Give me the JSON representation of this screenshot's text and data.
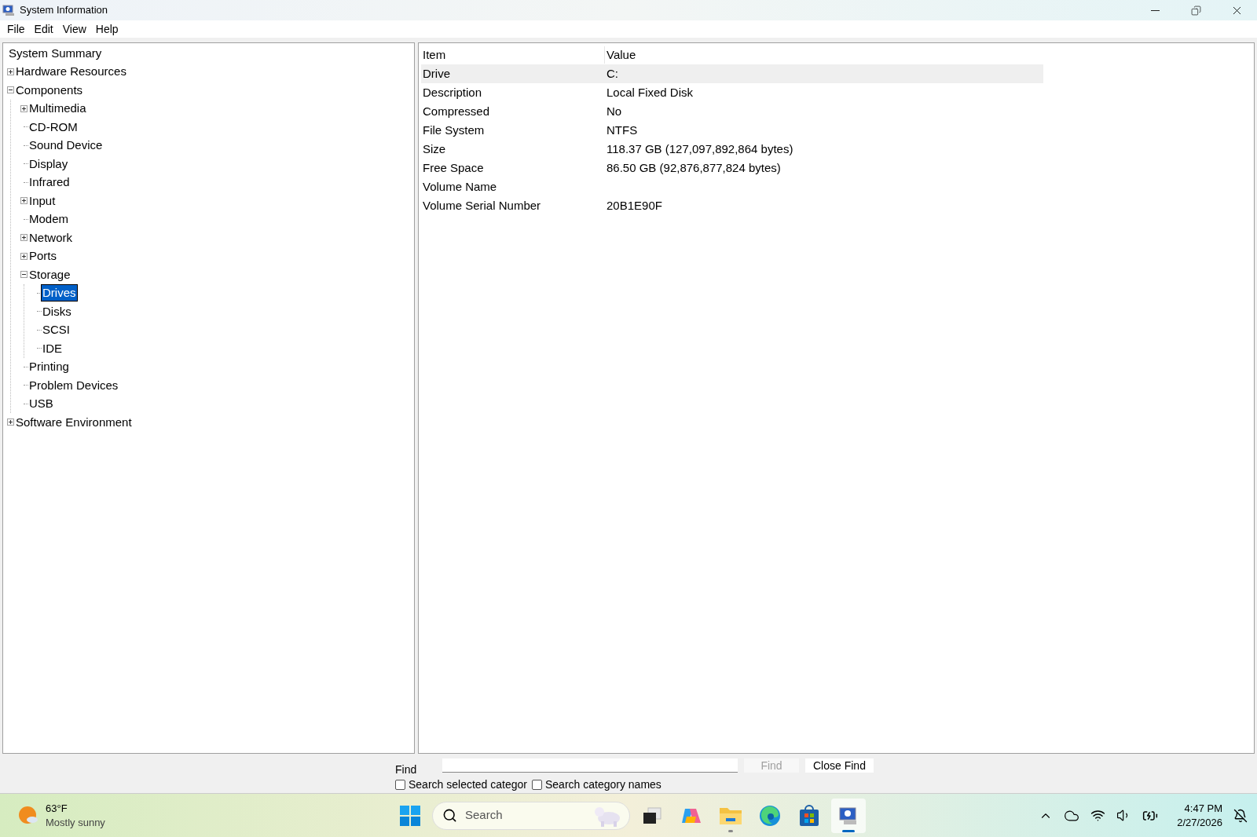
{
  "window": {
    "title": "System Information"
  },
  "menu": [
    "File",
    "Edit",
    "View",
    "Help"
  ],
  "tree": [
    {
      "label": "System Summary",
      "selected": false,
      "children": [
        {
          "label": "Hardware Resources",
          "selected": false,
          "expanded": false
        },
        {
          "label": "Components",
          "selected": false,
          "expanded": true,
          "children": [
            {
              "label": "Multimedia",
              "selected": false,
              "expanded": false
            },
            {
              "label": "CD-ROM",
              "selected": false
            },
            {
              "label": "Sound Device",
              "selected": false
            },
            {
              "label": "Display",
              "selected": false
            },
            {
              "label": "Infrared",
              "selected": false
            },
            {
              "label": "Input",
              "selected": false,
              "expanded": false
            },
            {
              "label": "Modem",
              "selected": false
            },
            {
              "label": "Network",
              "selected": false,
              "expanded": false
            },
            {
              "label": "Ports",
              "selected": false,
              "expanded": false
            },
            {
              "label": "Storage",
              "selected": false,
              "expanded": true,
              "children": [
                {
                  "label": "Drives",
                  "selected": true
                },
                {
                  "label": "Disks",
                  "selected": false
                },
                {
                  "label": "SCSI",
                  "selected": false
                },
                {
                  "label": "IDE",
                  "selected": false
                }
              ]
            },
            {
              "label": "Printing",
              "selected": false
            },
            {
              "label": "Problem Devices",
              "selected": false
            },
            {
              "label": "USB",
              "selected": false
            }
          ]
        },
        {
          "label": "Software Environment",
          "selected": false,
          "expanded": false
        }
      ]
    }
  ],
  "table": {
    "columns": [
      "Item",
      "Value"
    ],
    "rows": [
      {
        "item": "Drive",
        "value": "C:",
        "selected": true
      },
      {
        "item": "Description",
        "value": "Local Fixed Disk",
        "selected": false
      },
      {
        "item": "Compressed",
        "value": "No",
        "selected": false
      },
      {
        "item": "File System",
        "value": "NTFS",
        "selected": false
      },
      {
        "item": "Size",
        "value": "118.37 GB (127,097,892,864 bytes)",
        "selected": false
      },
      {
        "item": "Free Space",
        "value": "86.50 GB (92,876,877,824 bytes)",
        "selected": false
      },
      {
        "item": "Volume Name",
        "value": "",
        "selected": false
      },
      {
        "item": "Volume Serial Number",
        "value": "20B1E90F",
        "selected": false
      }
    ]
  },
  "find": {
    "label": "Find",
    "buttons": [
      {
        "label": "Find",
        "disabled": true
      },
      {
        "label": "Close Find",
        "disabled": false
      }
    ],
    "checkboxes": [
      {
        "label": "Search selected categor",
        "checked": false
      },
      {
        "label": "Search category names",
        "checked": false
      }
    ]
  },
  "taskbar": {
    "weather": {
      "temperature": "63°F",
      "condition": "Mostly sunny"
    },
    "search": {
      "placeholder": "Search"
    },
    "apps": [
      {
        "kind": "taskview",
        "running": false,
        "active": false
      },
      {
        "kind": "copilot",
        "running": false,
        "active": false
      },
      {
        "kind": "explorer",
        "running": true,
        "active": false
      },
      {
        "kind": "edge",
        "running": false,
        "active": false
      },
      {
        "kind": "store",
        "running": false,
        "active": false
      },
      {
        "kind": "sysinfo",
        "running": true,
        "active": true
      }
    ],
    "time": "4:47 PM",
    "date": "2/27/2026"
  }
}
